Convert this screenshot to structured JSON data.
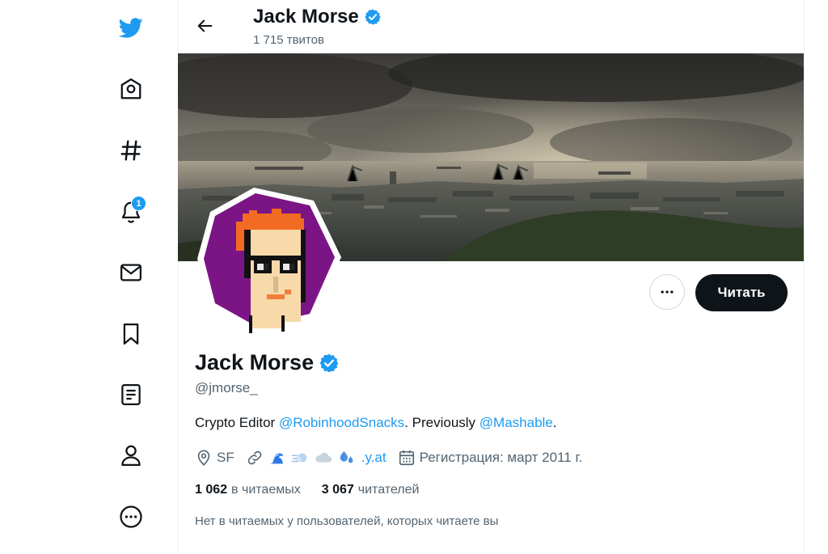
{
  "profile": {
    "name": "Jack Morse",
    "tweet_count": "1 715 твитов",
    "handle": "@jmorse_",
    "bio": {
      "prefix": "Crypto Editor ",
      "mention1": "@RobinhoodSnacks",
      "middle": ". Previously ",
      "mention2": "@Mashable",
      "suffix": "."
    },
    "location": "SF",
    "website_suffix": ".y.at",
    "joined": "Регистрация: март 2011 г.",
    "following_count": "1 062",
    "following_label": "в читаемых",
    "followers_count": "3 067",
    "followers_label": "читателей",
    "followers_you_know": "Нет в читаемых у пользователей, которых читаете вы"
  },
  "actions": {
    "follow_label": "Читать"
  },
  "sidebar": {
    "items": [
      {
        "icon": "twitter-bird-icon"
      },
      {
        "icon": "home-icon"
      },
      {
        "icon": "hashtag-icon"
      },
      {
        "icon": "bell-icon",
        "badge": "1"
      },
      {
        "icon": "mail-icon"
      },
      {
        "icon": "bookmark-icon"
      },
      {
        "icon": "list-icon"
      },
      {
        "icon": "profile-icon"
      },
      {
        "icon": "more-icon"
      }
    ]
  },
  "colors": {
    "accent": "#1d9bf0",
    "text": "#0f1419",
    "secondary": "#536471",
    "avatar_bg": "#7b1585"
  }
}
